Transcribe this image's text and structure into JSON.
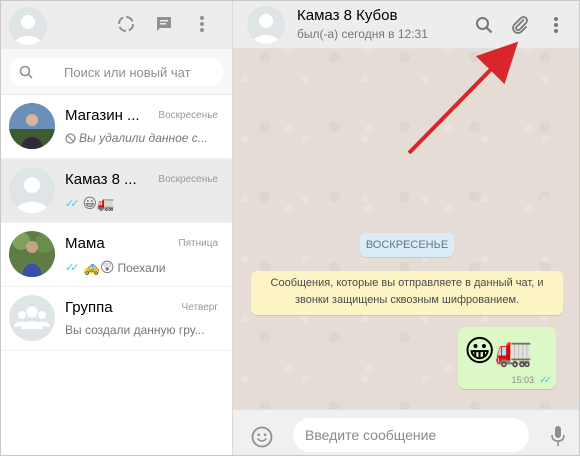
{
  "search": {
    "placeholder": "Поиск или новый чат"
  },
  "chats": [
    {
      "name": "Магазин ...",
      "time": "Воскресенье",
      "preview": "Вы удалили данное с...",
      "preview_icon": "blocked-icon"
    },
    {
      "name": "Камаз 8 ...",
      "time": "Воскресенье",
      "preview_emoji": "😀🚛",
      "ticks": "✓✓"
    },
    {
      "name": "Мама",
      "time": "Пятница",
      "preview_emoji": "🚕😲",
      "preview": "Поехали",
      "ticks": "✓✓"
    },
    {
      "name": "Группа",
      "time": "Четверг",
      "preview": "Вы создали данную гру..."
    }
  ],
  "conversation": {
    "contact_name": "Камаз 8 Кубов",
    "contact_status": "был(-а) сегодня в 12:31",
    "day_label": "ВОСКРЕСЕНЬЕ",
    "encryption_notice": "Сообщения, которые вы отправляете в данный чат, и звонки защищены сквозным шифрованием.",
    "message": {
      "content": "😀🚛",
      "time": "15:03",
      "ticks": "✓✓"
    }
  },
  "composer": {
    "placeholder": "Введите сообщение"
  },
  "colors": {
    "accent_arrow": "#d9262b",
    "bubble_out": "#dcf8c6",
    "notice_bg": "#fcf4c4",
    "day_chip_bg": "#dcecf6",
    "tick_blue": "#4fc3f7"
  }
}
